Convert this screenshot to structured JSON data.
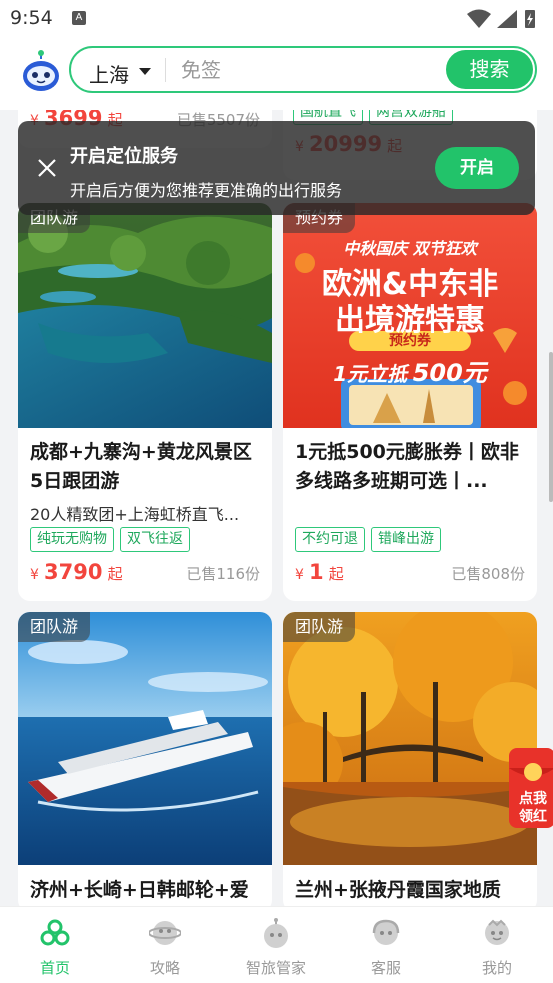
{
  "status_bar": {
    "time": "9:54",
    "notif": "A"
  },
  "header": {
    "city": "上海",
    "search_placeholder": "免签",
    "search_button": "搜索"
  },
  "cards": [
    {
      "id": "top-left-partial",
      "price_currency": "¥",
      "price": "3699",
      "price_suffix": "起",
      "sold": "已售5507份"
    },
    {
      "id": "top-right-partial",
      "tags": [
        "国航直飞",
        "两宫双游船"
      ],
      "price_currency": "¥",
      "price": "20999",
      "price_suffix": "起"
    },
    {
      "id": "jiuzhaigou",
      "badge": "团队游",
      "title": "成都+九寨沟+黄龙风景区5日跟团游",
      "subtitle": "20人精致团+上海虹桥直飞...",
      "tags": [
        "纯玩无购物",
        "双飞往返"
      ],
      "price_currency": "¥",
      "price": "3790",
      "price_suffix": "起",
      "sold": "已售116份"
    },
    {
      "id": "coupon",
      "badge": "预约券",
      "title": "1元抵500元膨胀券丨欧非多线路多班期可选丨...",
      "tags": [
        "不约可退",
        "错峰出游"
      ],
      "price_currency": "¥",
      "price": "1",
      "price_suffix": "起",
      "sold": "已售808份",
      "poster": {
        "line1": "中秋国庆 双节狂欢",
        "line2": "欧洲&中东非",
        "line3": "出境游特惠",
        "pill": "预约券",
        "deal_prefix": "1元立抵",
        "deal_value": "500元"
      }
    },
    {
      "id": "cruise",
      "badge": "团队游",
      "title": "济州+长崎+日韩邮轮+爱"
    },
    {
      "id": "lanzhou",
      "badge": "团队游",
      "title": "兰州+张掖丹霞国家地质"
    }
  ],
  "toast": {
    "title": "开启定位服务",
    "text": "开启后方便为您推荐更准确的出行服务",
    "button": "开启"
  },
  "redpack": {
    "line1": "点我",
    "line2": "领红"
  },
  "tabbar": [
    {
      "label": "首页",
      "icon": "home-icon",
      "active": true
    },
    {
      "label": "攻略",
      "icon": "guide-icon",
      "active": false
    },
    {
      "label": "智旅管家",
      "icon": "assistant-icon",
      "active": false
    },
    {
      "label": "客服",
      "icon": "service-icon",
      "active": false
    },
    {
      "label": "我的",
      "icon": "profile-icon",
      "active": false
    }
  ],
  "colors": {
    "accent": "#22c36a",
    "price": "#f2453d"
  }
}
